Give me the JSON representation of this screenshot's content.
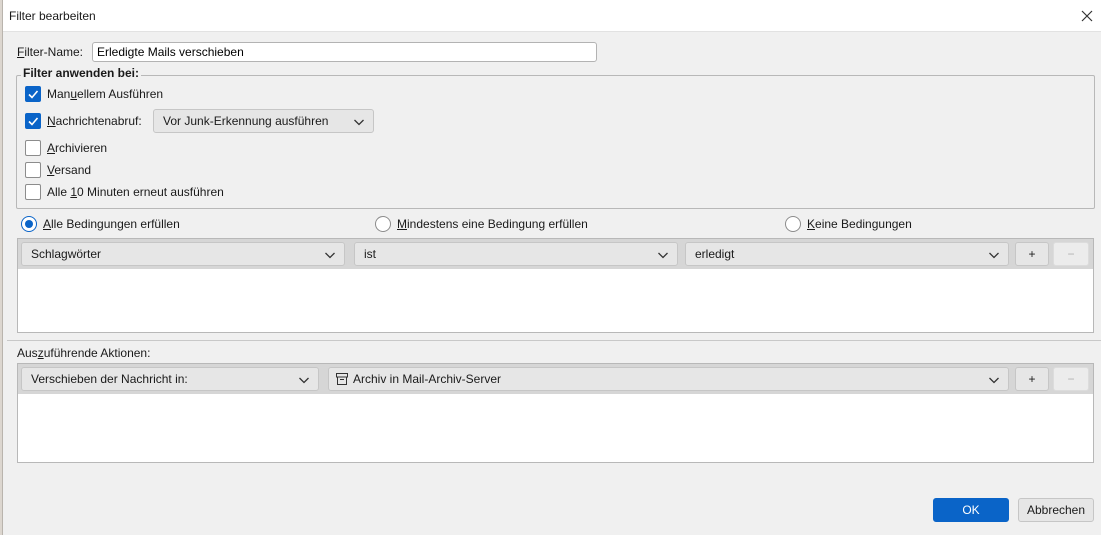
{
  "window": {
    "title": "Filter bearbeiten"
  },
  "filter_name": {
    "label_prefix": "F",
    "label_rest": "ilter-Name:",
    "value": "Erledigte Mails verschieben"
  },
  "apply_group": {
    "legend": "Filter anwenden bei:",
    "manual": {
      "pre": "Man",
      "key": "u",
      "post": "ellem Ausführen",
      "checked": true
    },
    "fetch": {
      "pre": "",
      "key": "N",
      "post": "achrichtenabruf:",
      "checked": true,
      "option": "Vor Junk-Erkennung ausführen"
    },
    "archive": {
      "pre": "",
      "key": "A",
      "post": "rchivieren",
      "checked": false
    },
    "send": {
      "pre": "",
      "key": "V",
      "post": "ersand",
      "checked": false
    },
    "periodic": {
      "pre": "Alle ",
      "key": "1",
      "post": "0 Minuten erneut ausführen",
      "checked": false
    }
  },
  "match": {
    "all": {
      "pre": "",
      "key": "A",
      "post": "lle Bedingungen erfüllen",
      "selected": true
    },
    "any": {
      "pre": "",
      "key": "M",
      "post": "indestens eine Bedingung erfüllen",
      "selected": false
    },
    "none": {
      "pre": "",
      "key": "K",
      "post": "eine Bedingungen",
      "selected": false
    }
  },
  "condition": {
    "field": "Schlagwörter",
    "operator": "ist",
    "value": "erledigt",
    "add_label": "+",
    "remove_label": "−"
  },
  "actions": {
    "label_pre": "Aus",
    "label_key": "z",
    "label_post": "uführende Aktionen:",
    "action": "Verschieben der Nachricht in:",
    "target": "Archiv in Mail-Archiv-Server",
    "add_label": "+",
    "remove_label": "−"
  },
  "buttons": {
    "ok": "OK",
    "cancel": "Abbrechen"
  },
  "colors": {
    "accent": "#0a64c8",
    "window_bg": "#f0f0f0"
  }
}
